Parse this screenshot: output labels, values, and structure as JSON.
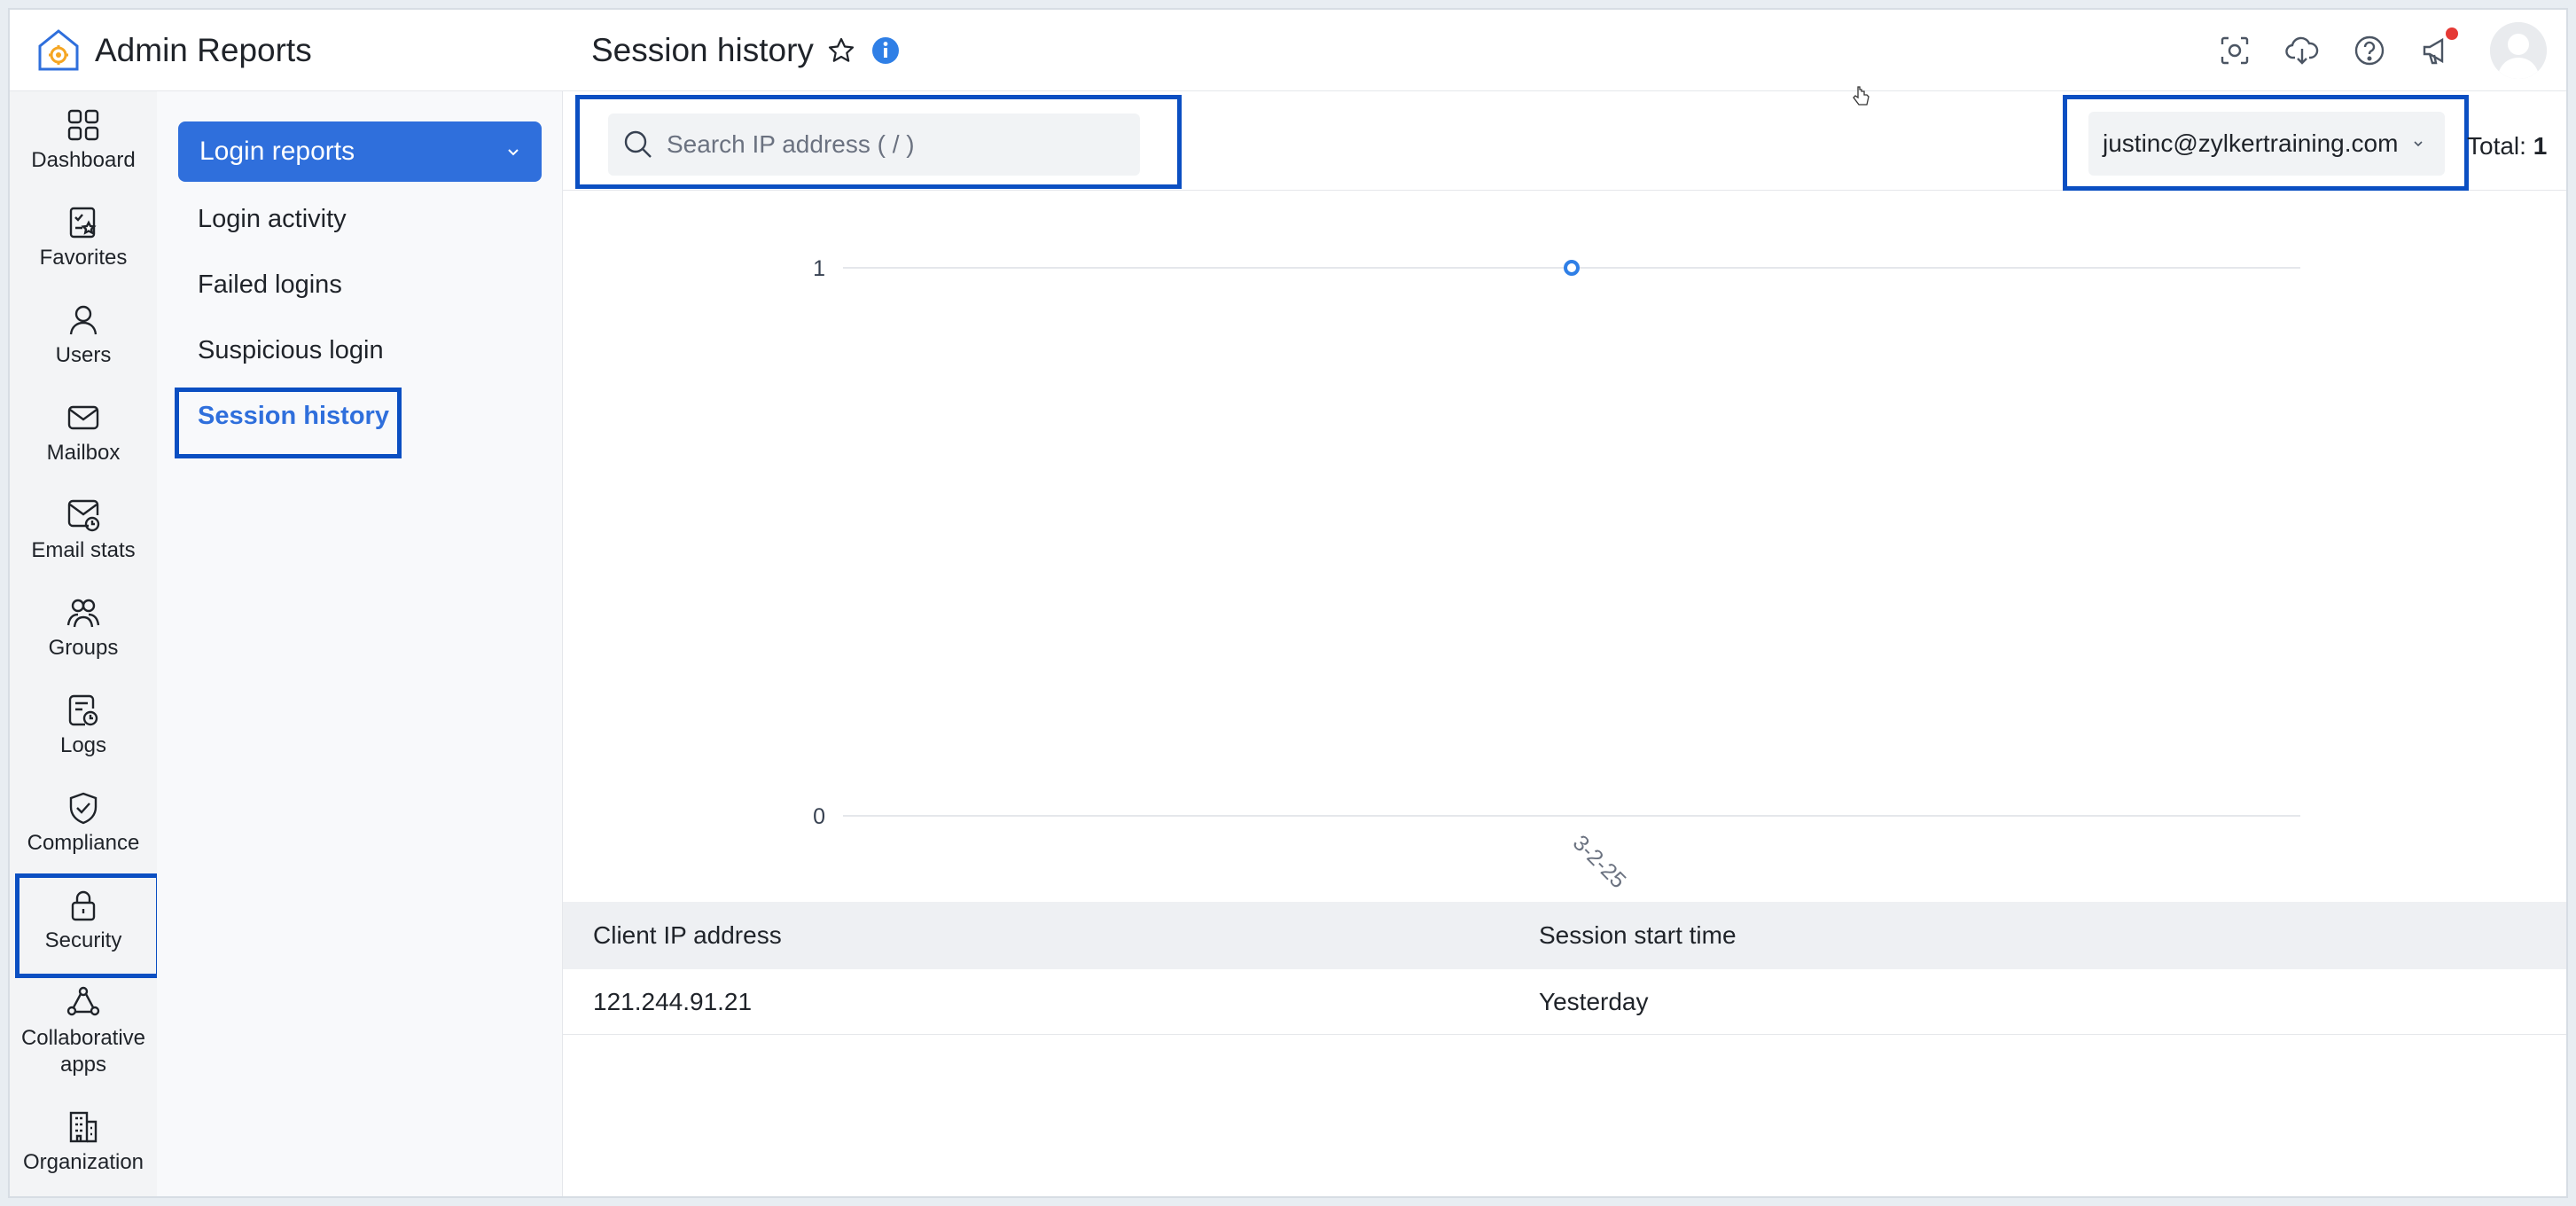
{
  "app": {
    "title": "Admin Reports"
  },
  "rail": {
    "items": [
      {
        "label": "Dashboard",
        "icon": "dashboard-icon"
      },
      {
        "label": "Favorites",
        "icon": "favorites-icon"
      },
      {
        "label": "Users",
        "icon": "user-icon"
      },
      {
        "label": "Mailbox",
        "icon": "mail-icon"
      },
      {
        "label": "Email stats",
        "icon": "email-stats-icon"
      },
      {
        "label": "Groups",
        "icon": "groups-icon"
      },
      {
        "label": "Logs",
        "icon": "logs-icon"
      },
      {
        "label": "Compliance",
        "icon": "shield-icon"
      },
      {
        "label": "Security",
        "icon": "lock-icon",
        "active": true
      },
      {
        "label": "Collaborative apps",
        "icon": "collaborative-icon"
      },
      {
        "label": "Organization",
        "icon": "building-icon"
      }
    ]
  },
  "submenu": {
    "header": "Login reports",
    "items": [
      {
        "label": "Login activity"
      },
      {
        "label": "Failed logins"
      },
      {
        "label": "Suspicious login"
      },
      {
        "label": "Session history",
        "active": true
      }
    ]
  },
  "page": {
    "title": "Session history"
  },
  "toolbar": {
    "search_placeholder": "Search IP address ( / )",
    "user_value": "justinc@zylkertraining.com",
    "total_label": "Total:",
    "total_value": "1"
  },
  "chart_data": {
    "type": "line",
    "categories": [
      "3-2-25"
    ],
    "series": [
      {
        "values": [
          1
        ]
      }
    ],
    "ylim": [
      0,
      1
    ],
    "yticks": [
      "0",
      "1"
    ],
    "grid": true,
    "accent_color": "#2f7fe6"
  },
  "table": {
    "headers": [
      "Client IP address",
      "Session start time"
    ],
    "rows": [
      [
        "121.244.91.21",
        "Yesterday"
      ]
    ]
  },
  "colors": {
    "accent": "#2f6fdc",
    "highlight_border": "#0b4fc2",
    "notification": "#e53935"
  }
}
